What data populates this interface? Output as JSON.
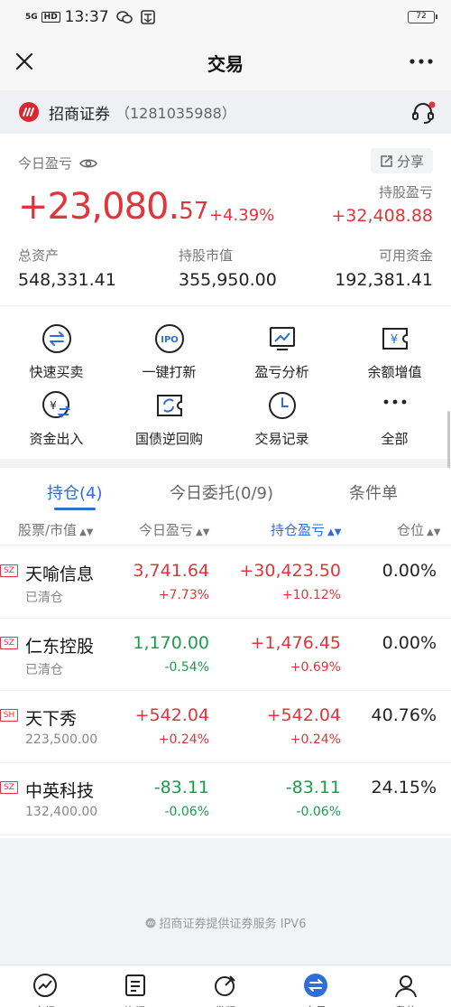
{
  "status_bar": {
    "signal": "5G",
    "hd": "HD",
    "time": "13:37",
    "battery": "72"
  },
  "nav": {
    "title": "交易"
  },
  "broker": {
    "name": "招商证券",
    "account": "（1281035988）"
  },
  "summary": {
    "today_pl_label": "今日盈亏",
    "share_label": "分享",
    "today_pl_int": "+23,080.",
    "today_pl_dec": "57",
    "today_pl_pct": "+4.39%",
    "holding_pl_label": "持股盈亏",
    "holding_pl_value": "+32,408.88",
    "total_assets_label": "总资产",
    "total_assets_value": "548,331.41",
    "market_value_label": "持股市值",
    "market_value_value": "355,950.00",
    "available_label": "可用资金",
    "available_value": "192,381.41"
  },
  "functions": [
    {
      "label": "快速买卖",
      "icon": "swap-icon"
    },
    {
      "label": "一键打新",
      "icon": "ipo-icon"
    },
    {
      "label": "盈亏分析",
      "icon": "chart-monitor-icon"
    },
    {
      "label": "余额增值",
      "icon": "yen-ticket-icon"
    },
    {
      "label": "资金出入",
      "icon": "yen-transfer-icon"
    },
    {
      "label": "国债逆回购",
      "icon": "repo-ticket-icon"
    },
    {
      "label": "交易记录",
      "icon": "clock-icon"
    },
    {
      "label": "全部",
      "icon": "more-dots-icon"
    }
  ],
  "tabs": [
    "持仓(4)",
    "今日委托(0/9)",
    "条件单"
  ],
  "columns": [
    "股票/市值",
    "今日盈亏",
    "持仓盈亏",
    "仓位"
  ],
  "holdings": [
    {
      "market": "SZ",
      "name": "天喻信息",
      "sub": "已清仓",
      "today_pl": "3,741.64",
      "today_pct": "+7.73%",
      "hold_pl": "+30,423.50",
      "hold_pct": "+10.12%",
      "position": "0.00%",
      "today_color": "red",
      "hold_color": "red"
    },
    {
      "market": "SZ",
      "name": "仁东控股",
      "sub": "已清仓",
      "today_pl": "1,170.00",
      "today_pct": "-0.54%",
      "hold_pl": "+1,476.45",
      "hold_pct": "+0.69%",
      "position": "0.00%",
      "today_color": "green",
      "hold_color": "red"
    },
    {
      "market": "SH",
      "name": "天下秀",
      "sub": "223,500.00",
      "today_pl": "+542.04",
      "today_pct": "+0.24%",
      "hold_pl": "+542.04",
      "hold_pct": "+0.24%",
      "position": "40.76%",
      "today_color": "red",
      "hold_color": "red"
    },
    {
      "market": "SZ",
      "name": "中英科技",
      "sub": "132,400.00",
      "today_pl": "-83.11",
      "today_pct": "-0.06%",
      "hold_pl": "-83.11",
      "hold_pct": "-0.06%",
      "position": "24.15%",
      "today_color": "green",
      "hold_color": "green"
    }
  ],
  "footer": {
    "note": "招商证券提供证券服务  IPV6"
  },
  "bottom_nav": [
    "市场",
    "资讯",
    "发现",
    "交易",
    "我的"
  ],
  "colors": {
    "up": "#e0353a",
    "down": "#1e9b4e",
    "accent": "#2f6dd8"
  }
}
